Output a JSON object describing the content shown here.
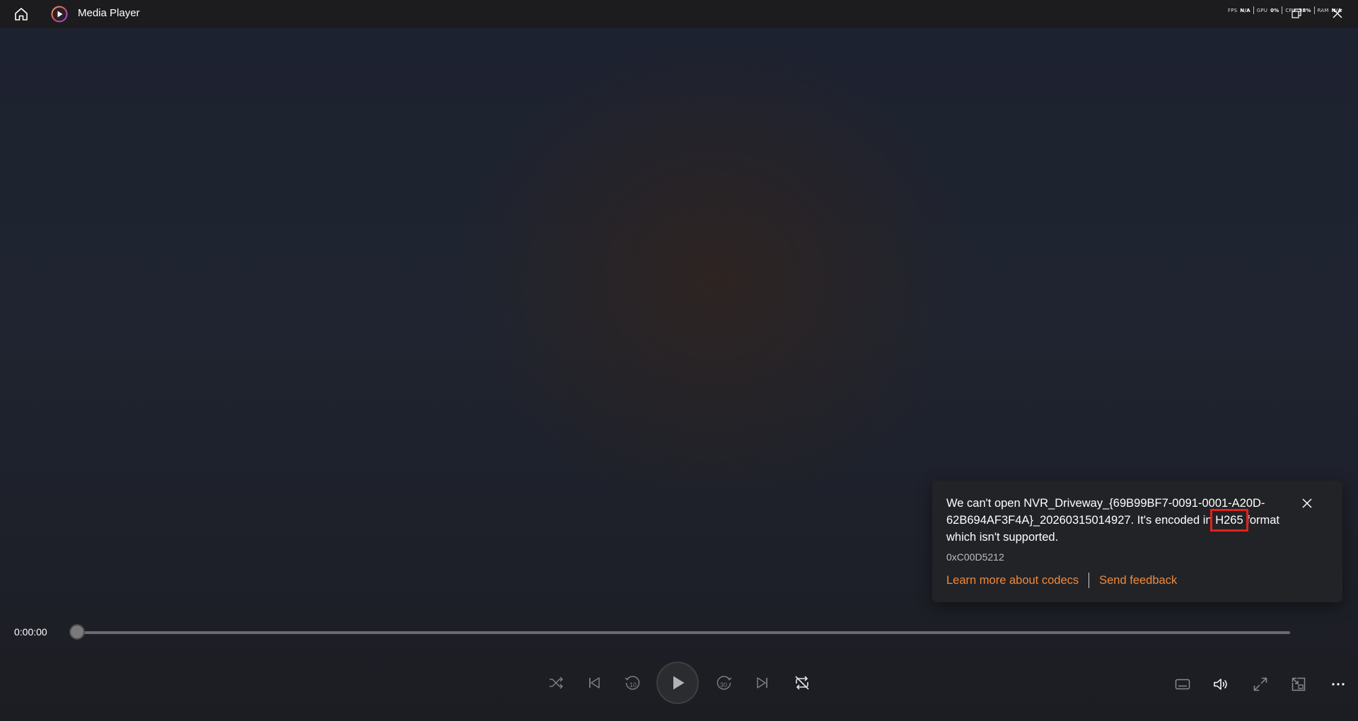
{
  "titlebar": {
    "app_title": "Media Player",
    "home_icon": "home-icon",
    "app_logo_icon": "media-player-logo-icon",
    "perf": {
      "fps_label": "FPS",
      "fps_value": "N/A",
      "gpu_label": "GPU",
      "gpu_value": "0%",
      "cpu_label": "CPU",
      "cpu_value": "38%",
      "ram_label": "RAM",
      "ram_value": "N/A"
    }
  },
  "notification": {
    "message_before": "We can't open NVR_Driveway_{69B99BF7-0091-0001-A20D-62B694AF3F4A}_20260315014927. It's encoded in ",
    "highlight": "H265",
    "message_after": " format which isn't supported.",
    "error_code": "0xC00D5212",
    "learn_more_link": "Learn more about codecs",
    "feedback_link": "Send feedback",
    "accent_color": "#f08a3a",
    "highlight_color": "#e0231a"
  },
  "playback": {
    "current_time": "0:00:00",
    "progress": 0
  },
  "controls": {
    "shuffle_icon": "shuffle-icon",
    "previous_icon": "previous-icon",
    "rewind_icon": "rewind-10-icon",
    "rewind_seconds": "10",
    "play_icon": "play-icon",
    "forward_icon": "forward-30-icon",
    "forward_seconds": "30",
    "next_icon": "next-icon",
    "repeat_icon": "repeat-off-icon",
    "subtitles_icon": "subtitles-icon",
    "volume_icon": "volume-icon",
    "fullscreen_icon": "fullscreen-icon",
    "miniplayer_icon": "miniplayer-icon",
    "more_icon": "more-icon"
  }
}
